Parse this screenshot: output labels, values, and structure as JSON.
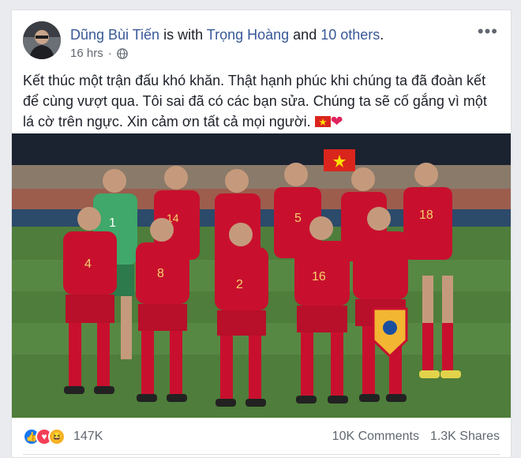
{
  "post": {
    "author": "Dũng Bùi Tiến",
    "with_text": " is with ",
    "tagged": "Trọng Hoàng",
    "and_text": " and ",
    "others": "10 others",
    "period": ".",
    "time": "16 hrs",
    "time_sep": "·",
    "privacy_icon": "globe-icon",
    "more_icon": "more-options-icon",
    "text": "Kết thúc một trận đấu khó khăn. Thật hạnh phúc khi chúng ta đã đoàn kết để cùng vượt qua. Tôi sai đã có các bạn sửa. Chúng ta sẽ cố gắng vì một lá cờ trên ngực. Xin cảm ơn tất cả mọi người.",
    "emoji": [
      "vietnam-flag-icon",
      "red-heart-icon"
    ],
    "photo": {
      "description_icon": "team-photo-image",
      "jersey_numbers": [
        "1",
        "14",
        "5",
        "18",
        "4",
        "8",
        "2",
        "16"
      ]
    }
  },
  "reactions": {
    "icons": [
      "like-icon",
      "love-icon",
      "haha-icon"
    ],
    "count": "147K",
    "comments": "10K Comments",
    "shares": "1.3K Shares"
  },
  "colors": {
    "link": "#385898",
    "jersey": "#c8102e",
    "pitch": "#4f7d3b"
  }
}
